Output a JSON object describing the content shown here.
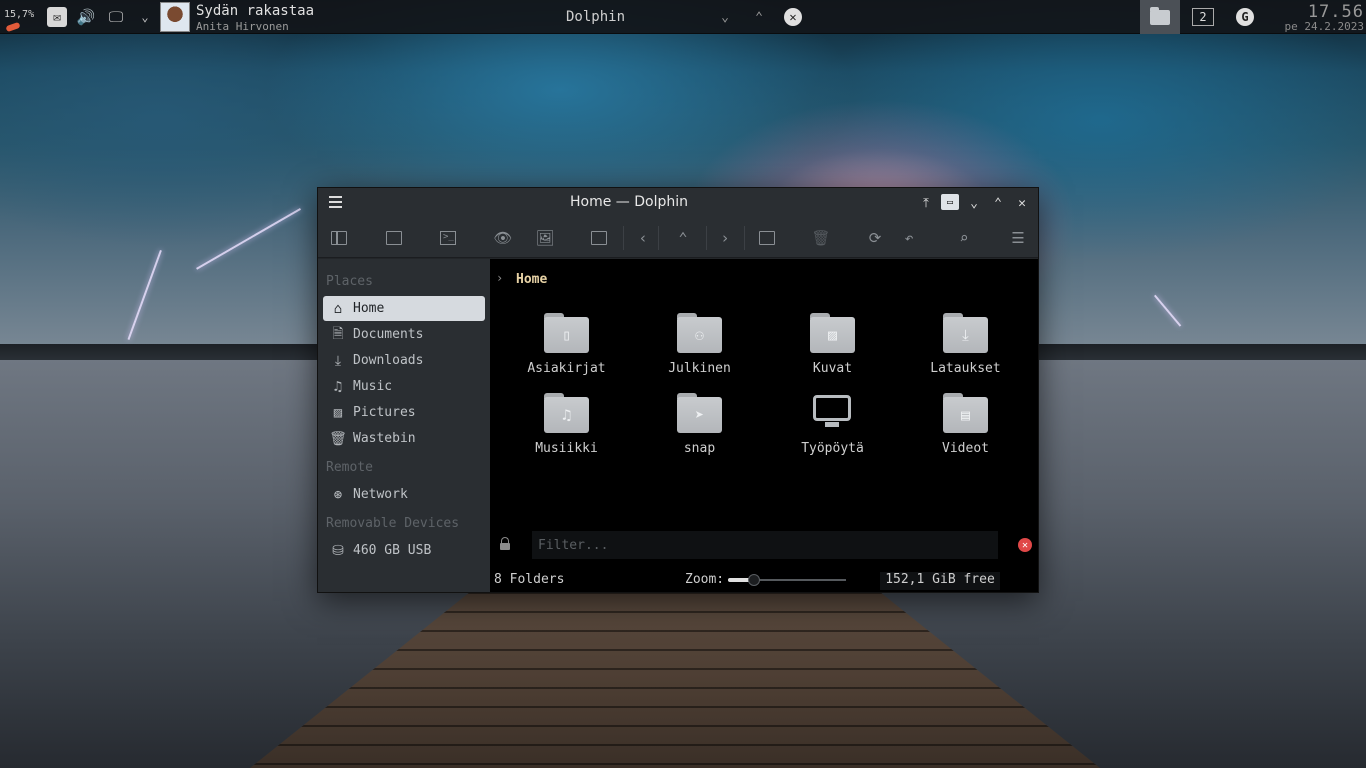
{
  "panel": {
    "cpu_text": "15,7%",
    "media": {
      "song": "Sydän rakastaa",
      "artist": "Anita Hirvonen"
    },
    "task": {
      "title": "Dolphin"
    },
    "pager": {
      "desktop_label": "2"
    },
    "clock": {
      "time": "17.56",
      "date": "pe 24.2.2023"
    },
    "icons": [
      "mail-icon",
      "volume-icon",
      "display-icon",
      "chevron-down-icon",
      "album-art",
      "minimize-icon",
      "maximize-icon",
      "close-icon",
      "dolphin-task-icon",
      "google-icon"
    ]
  },
  "window": {
    "title": "Home — Dolphin",
    "toolbar_icons": [
      "split-view-icon",
      "new-window-icon",
      "terminal-icon",
      "preview-icon",
      "image-icon",
      "new-folder-icon",
      "back-icon",
      "up-icon",
      "forward-icon",
      "new-file-icon",
      "trash-icon",
      "reload-icon",
      "undo-icon",
      "search-icon",
      "menu-icon"
    ]
  },
  "sidebar": {
    "places_title": "Places",
    "places": [
      {
        "label": "Home",
        "icon": "home-icon",
        "active": true
      },
      {
        "label": "Documents",
        "icon": "documents-icon"
      },
      {
        "label": "Downloads",
        "icon": "downloads-icon"
      },
      {
        "label": "Music",
        "icon": "music-icon"
      },
      {
        "label": "Pictures",
        "icon": "pictures-icon"
      },
      {
        "label": "Wastebin",
        "icon": "wastebin-icon"
      }
    ],
    "remote_title": "Remote",
    "remote": [
      {
        "label": "Network",
        "icon": "network-icon"
      }
    ],
    "removable_title": "Removable Devices",
    "removable": [
      {
        "label": "460 GB USB",
        "icon": "usb-drive-icon"
      }
    ]
  },
  "content": {
    "breadcrumb": "Home",
    "items": [
      {
        "name": "Asiakirjat",
        "icon": "documents-folder-icon"
      },
      {
        "name": "Julkinen",
        "icon": "public-folder-icon"
      },
      {
        "name": "Kuvat",
        "icon": "pictures-folder-icon"
      },
      {
        "name": "Lataukset",
        "icon": "downloads-folder-icon"
      },
      {
        "name": "Musiikki",
        "icon": "music-folder-icon"
      },
      {
        "name": "snap",
        "icon": "snap-folder-icon"
      },
      {
        "name": "Työpöytä",
        "icon": "desktop-icon"
      },
      {
        "name": "Videot",
        "icon": "videos-folder-icon"
      }
    ]
  },
  "filter": {
    "placeholder": "Filter..."
  },
  "status": {
    "count": "8 Folders",
    "zoom_label": "Zoom:",
    "zoom_level": 0.22,
    "free": "152,1 GiB free"
  },
  "colors": {
    "accent": "#e8d3a6",
    "selection": "#d6dadf",
    "window_bg": "#232629",
    "content_bg": "#000000"
  }
}
